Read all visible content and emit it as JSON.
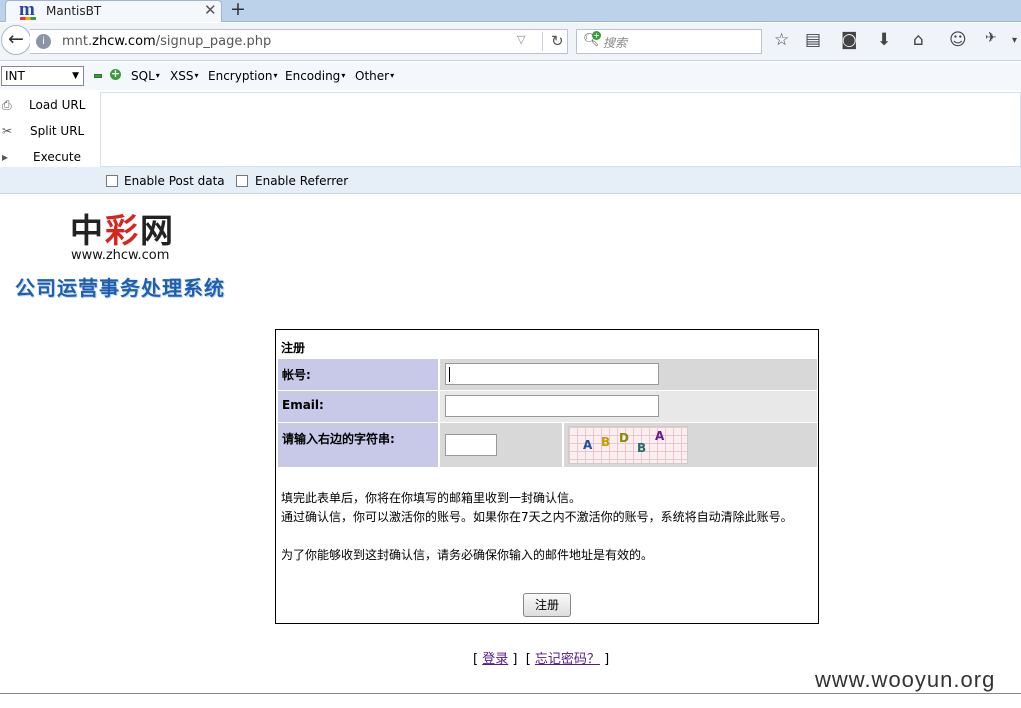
{
  "browser": {
    "tab_title": "MantisBT",
    "tab_close": "✕",
    "new_tab": "+",
    "url_prefix": "mnt.",
    "url_domain": "zhcw.com",
    "url_path": "/signup_page.php",
    "search_placeholder": "搜索"
  },
  "hackbar": {
    "select_value": "INT",
    "menus": [
      "SQL",
      "XSS",
      "Encryption",
      "Encoding",
      "Other"
    ],
    "actions": [
      "Load URL",
      "Split URL",
      "Execute"
    ],
    "options": [
      "Enable Post data",
      "Enable Referrer"
    ]
  },
  "logo": {
    "char1": "中",
    "char2": "彩",
    "char3": "网",
    "url": "www.zhcw.com",
    "subtitle": "公司运营事务处理系统"
  },
  "form": {
    "title": "注册",
    "username_label": "帐号:",
    "email_label": "Email:",
    "captcha_label": "请输入右边的字符串:",
    "captcha_chars": [
      "A",
      "B",
      "D",
      "B",
      "A"
    ],
    "desc_line1": "填完此表单后，你将在你填写的邮箱里收到一封确认信。",
    "desc_line2": "通过确认信，你可以激活你的账号。如果你在7天之内不激活你的账号，系统将自动清除此账号。",
    "desc_line3": "为了你能够收到这封确认信，请务必确保你输入的邮件地址是有效的。",
    "submit": "注册"
  },
  "links": {
    "login": "登录",
    "forgot": "忘记密码？"
  },
  "watermark": "www.wooyun.org",
  "colors": {
    "label_bg": "#c8c8e8",
    "row_bg_1": "#d8d8d8",
    "row_bg_2": "#e8e8e8",
    "logo_red": "#d8241e",
    "subtitle_blue": "#1f5fae"
  }
}
